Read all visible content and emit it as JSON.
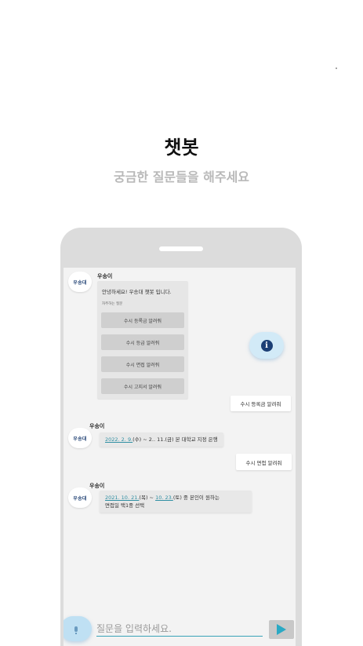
{
  "header": {
    "title": "챗봇",
    "subtitle": "궁금한 질문들을 해주세요"
  },
  "chat": {
    "bot_name": "우송이",
    "logo_text": "우송대",
    "greeting": "안녕하세요! 우송대 챗봇 입니다.",
    "faq_label": "자주하는 질문",
    "options": [
      "수시 등록금 알려줘",
      "수시 등급 알려줘",
      "수시 면접 알려줘",
      "수시 고지서 알려줘"
    ],
    "user_messages": [
      "수시 등록금 알려줘",
      "수시 면접 알려줘"
    ],
    "reply1": {
      "link": "2022. 2. 9.",
      "text": "(수) ~ 2.. 11.(금) 본 대학교 지정 은행"
    },
    "reply2": {
      "link1": "2021. 10. 21.",
      "mid": "(목) ~ ",
      "link2": "10. 23.",
      "rest": "(토) 중 본인이 원하는",
      "line2": "면접일 택1중 선택"
    }
  },
  "input": {
    "placeholder": "질문을 입력하세요."
  },
  "icons": {
    "info": "info-icon",
    "mic": "microphone-icon",
    "send": "send-icon"
  },
  "colors": {
    "accent": "#2aa9c4",
    "info_button": "#1c3f75"
  }
}
